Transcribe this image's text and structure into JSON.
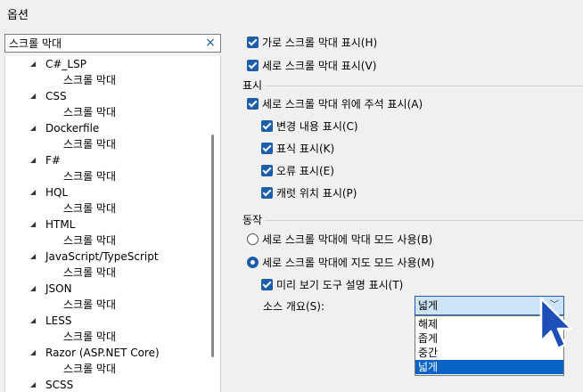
{
  "window": {
    "title": "옵션"
  },
  "search": {
    "value": "스크롤 막대",
    "clear_icon": "×"
  },
  "tree": {
    "items": [
      {
        "type": "category",
        "label": "C#_LSP"
      },
      {
        "type": "child",
        "label": "스크롤 막대"
      },
      {
        "type": "category",
        "label": "CSS"
      },
      {
        "type": "child",
        "label": "스크롤 막대"
      },
      {
        "type": "category",
        "label": "Dockerfile"
      },
      {
        "type": "child",
        "label": "스크롤 막대"
      },
      {
        "type": "category",
        "label": "F#"
      },
      {
        "type": "child",
        "label": "스크롤 막대"
      },
      {
        "type": "category",
        "label": "HQL"
      },
      {
        "type": "child",
        "label": "스크롤 막대"
      },
      {
        "type": "category",
        "label": "HTML"
      },
      {
        "type": "child",
        "label": "스크롤 막대"
      },
      {
        "type": "category",
        "label": "JavaScript/TypeScript"
      },
      {
        "type": "child",
        "label": "스크롤 막대"
      },
      {
        "type": "category",
        "label": "JSON"
      },
      {
        "type": "child",
        "label": "스크롤 막대"
      },
      {
        "type": "category",
        "label": "LESS"
      },
      {
        "type": "child",
        "label": "스크롤 막대"
      },
      {
        "type": "category",
        "label": "Razor (ASP.NET Core)"
      },
      {
        "type": "child",
        "label": "스크롤 막대"
      },
      {
        "type": "category",
        "label": "SCSS"
      }
    ]
  },
  "options": {
    "horizontal_scrollbar": {
      "label": "가로 스크롤 막대 표시(H)",
      "checked": true
    },
    "vertical_scrollbar": {
      "label": "세로 스크롤 막대 표시(V)",
      "checked": true
    },
    "display_section": {
      "title": "표시"
    },
    "annotations": {
      "label": "세로 스크롤 막대 위에 주석 표시(A)",
      "checked": true
    },
    "changes": {
      "label": "변경 내용 표시(C)",
      "checked": true
    },
    "marks": {
      "label": "표식 표시(K)",
      "checked": true
    },
    "errors": {
      "label": "오류 표시(E)",
      "checked": true
    },
    "caret": {
      "label": "캐럿 위치 표시(P)",
      "checked": true
    },
    "behavior_section": {
      "title": "동작"
    },
    "bar_mode": {
      "label": "세로 스크롤 막대에 막대 모드 사용(B)",
      "selected": false
    },
    "map_mode": {
      "label": "세로 스크롤 막대에 지도 모드 사용(M)",
      "selected": true
    },
    "preview_tooltip": {
      "label": "미리 보기 도구 설명 표시(T)",
      "checked": true
    },
    "source_overview": {
      "label": "소스 개요(S):",
      "value": "넓게",
      "options": [
        "해제",
        "좁게",
        "중간",
        "넓게"
      ]
    }
  },
  "colors": {
    "accent": "#1e5ea8",
    "selection": "#0a64c8",
    "dropdown_bg": "#cde4f7",
    "background": "#f0f0f0"
  }
}
